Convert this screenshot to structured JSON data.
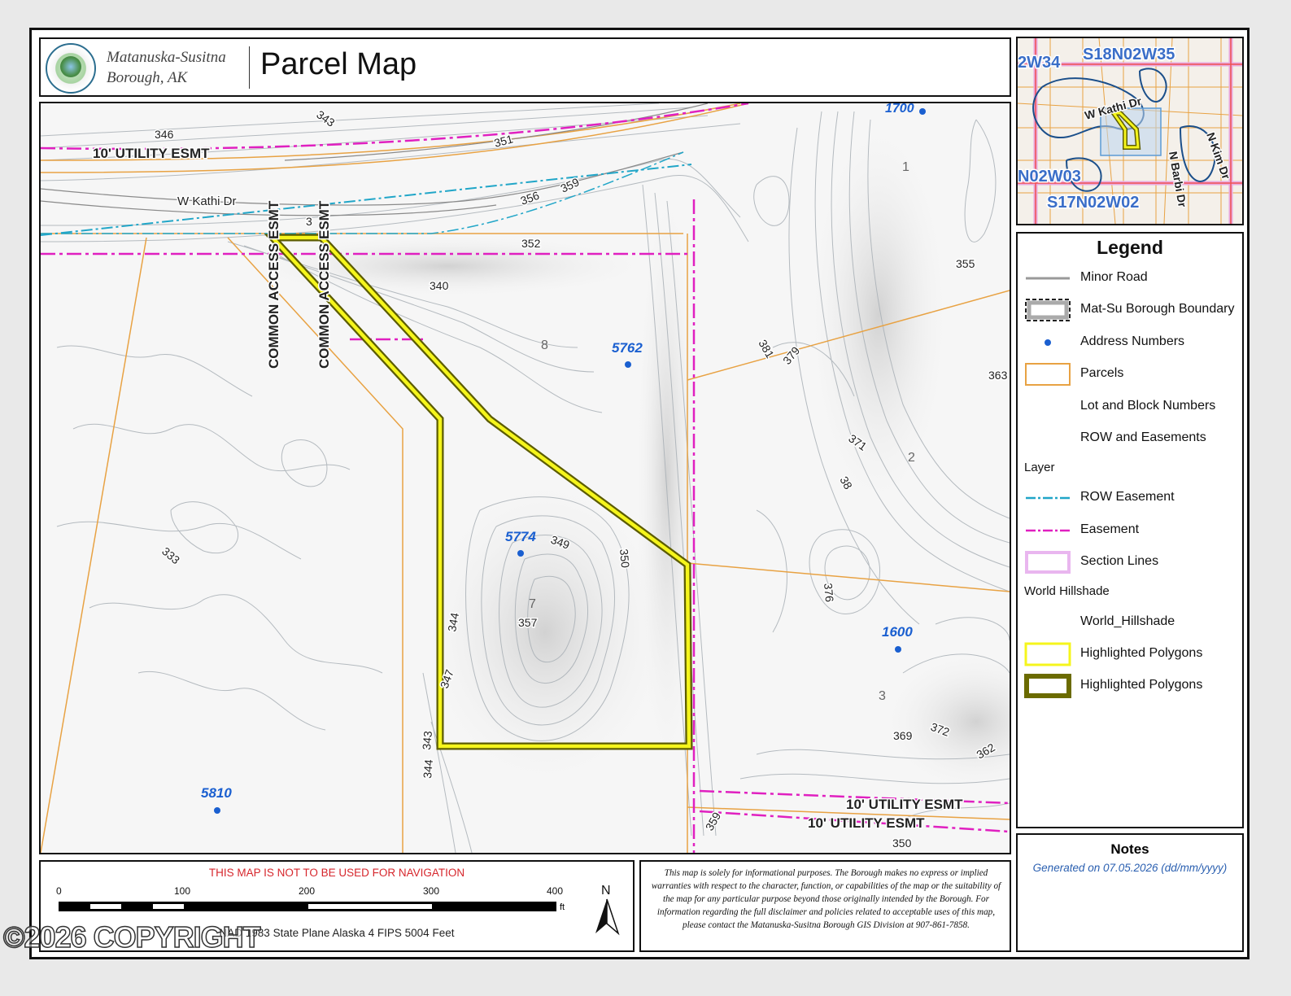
{
  "header": {
    "organization": "Matanuska-Susitna Borough, AK",
    "title": "Parcel Map"
  },
  "map": {
    "road_label": "W Kathi Dr",
    "easement_labels": [
      "10' UTILITY ESMT",
      "10' UTILITY ESMT",
      "10' UTILITY ESMT"
    ],
    "access_labels": [
      "COMMON ACCESS ESMT",
      "COMMON ACCESS ESMT"
    ],
    "address_numbers": [
      "1700",
      "5762",
      "5774",
      "1600",
      "5810"
    ],
    "lot_numbers": [
      "1",
      "2",
      "3",
      "7",
      "8"
    ],
    "contour_labels": [
      "346",
      "343",
      "351",
      "356",
      "359",
      "352",
      "340",
      "355",
      "381",
      "379",
      "363",
      "371",
      "376",
      "349",
      "350",
      "344",
      "357",
      "347",
      "343",
      "344",
      "369",
      "372",
      "362",
      "359",
      "350",
      "333",
      "3",
      "38"
    ]
  },
  "overview": {
    "labels": [
      "S18N02W35",
      "2W34",
      "N02W03",
      "S17N02W02",
      "W Kathi Dr",
      "N Barbi Dr",
      "N Kim Dr"
    ]
  },
  "legend": {
    "title": "Legend",
    "items": [
      {
        "label": "Minor Road",
        "symbol": "minor-road"
      },
      {
        "label": "Mat-Su Borough Boundary",
        "symbol": "borough-boundary"
      },
      {
        "label": "Address Numbers",
        "symbol": "address-dot"
      },
      {
        "label": "Parcels",
        "symbol": "parcel"
      },
      {
        "label": "Lot and Block Numbers",
        "symbol": "none"
      },
      {
        "label": "ROW and Easements",
        "symbol": "none"
      },
      {
        "label": "ROW Easement",
        "symbol": "row-easement"
      },
      {
        "label": "Easement",
        "symbol": "easement"
      },
      {
        "label": "Section Lines",
        "symbol": "section-lines"
      },
      {
        "label": "World_Hillshade",
        "symbol": "none"
      },
      {
        "label": "Highlighted Polygons",
        "symbol": "highlight-yellow"
      },
      {
        "label": "Highlighted Polygons",
        "symbol": "highlight-olive"
      }
    ],
    "sublabels": [
      "Layer",
      "World Hillshade"
    ],
    "colors": {
      "parcel": "#e8a243",
      "easement": "#e020c0",
      "row_easement": "#21a6c8",
      "address": "#1a5fd0",
      "highlight": "#f5f51c",
      "highlight_outline": "#6b6b00"
    }
  },
  "notes": {
    "title": "Notes",
    "generated": "Generated on  07.05.2026  (dd/mm/yyyy)"
  },
  "scale": {
    "warning": "THIS MAP IS NOT TO BE USED FOR NAVIGATION",
    "ticks": [
      "0",
      "100",
      "200",
      "300",
      "400"
    ],
    "unit": "ft",
    "projection": "NAD 1983 State Plane Alaska 4 FIPS 5004 Feet",
    "north": "N"
  },
  "disclaimer": "This map is solely for informational purposes. The Borough makes no express or implied warranties with respect to the character, function, or capabilities of the map or the suitability of the map for any particular purpose beyond those originally intended by the Borough. For information regarding the full disclaimer and policies related to acceptable uses of this map, please contact the Matanuska-Susitna Borough GIS Division at 907-861-7858.",
  "watermark": "©2026 COPYRIGHT"
}
